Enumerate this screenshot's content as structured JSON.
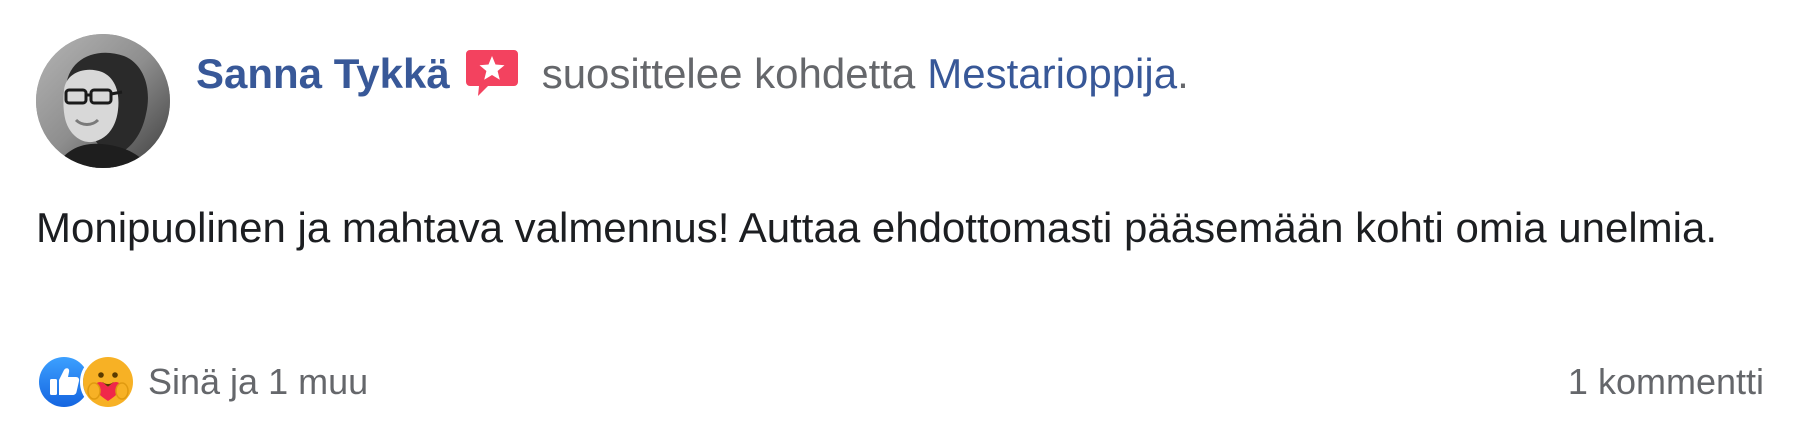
{
  "post": {
    "author": "Sanna Tykkä",
    "verb": "suosittelee kohdetta",
    "page_name": "Mestarioppija",
    "page_suffix": ".",
    "text": "Monipuolinen ja mahtava valmennus! Auttaa ehdottomasti pääsemään kohti omia unelmia.",
    "reactions": {
      "icons": [
        "like-icon",
        "care-icon"
      ],
      "summary": "Sinä ja 1 muu"
    },
    "comments": "1 kommentti"
  },
  "colors": {
    "link_blue": "#385898",
    "secondary_text": "#65676b",
    "primary_text": "#1c1e21",
    "recommend_red": "#f3425f",
    "like_blue": "#1877f2",
    "care_yellow": "#f7b125"
  }
}
